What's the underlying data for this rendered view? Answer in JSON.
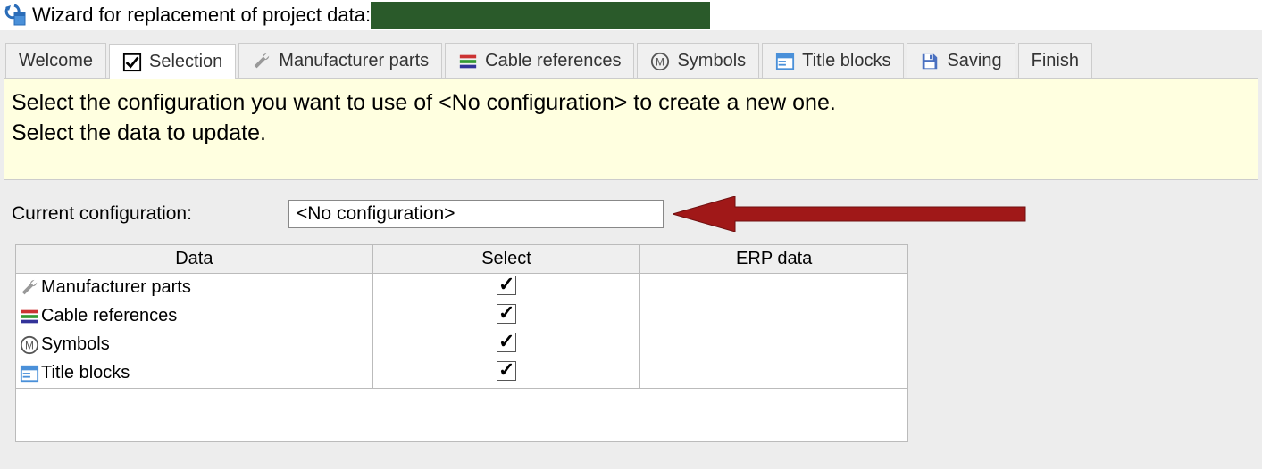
{
  "window": {
    "title": "Wizard for replacement of project data:"
  },
  "tabs": [
    {
      "label": "Welcome",
      "icon": null
    },
    {
      "label": "Selection",
      "icon": "checkbox-checked"
    },
    {
      "label": "Manufacturer parts",
      "icon": "wrench"
    },
    {
      "label": "Cable references",
      "icon": "cable"
    },
    {
      "label": "Symbols",
      "icon": "symbol-m"
    },
    {
      "label": "Title blocks",
      "icon": "titleblock"
    },
    {
      "label": "Saving",
      "icon": "save"
    },
    {
      "label": "Finish",
      "icon": null
    }
  ],
  "instruction": {
    "line1": "Select the configuration you want to use of <No configuration> to create a new one.",
    "line2": "Select the data to update."
  },
  "config": {
    "label": "Current configuration:",
    "value": "<No configuration>"
  },
  "grid": {
    "headers": {
      "data": "Data",
      "select": "Select",
      "erp": "ERP data"
    },
    "rows": [
      {
        "icon": "wrench",
        "label": "Manufacturer parts",
        "selected": true,
        "erp": ""
      },
      {
        "icon": "cable",
        "label": "Cable references",
        "selected": true,
        "erp": ""
      },
      {
        "icon": "symbol-m",
        "label": "Symbols",
        "selected": true,
        "erp": ""
      },
      {
        "icon": "titleblock",
        "label": "Title blocks",
        "selected": true,
        "erp": ""
      }
    ]
  }
}
